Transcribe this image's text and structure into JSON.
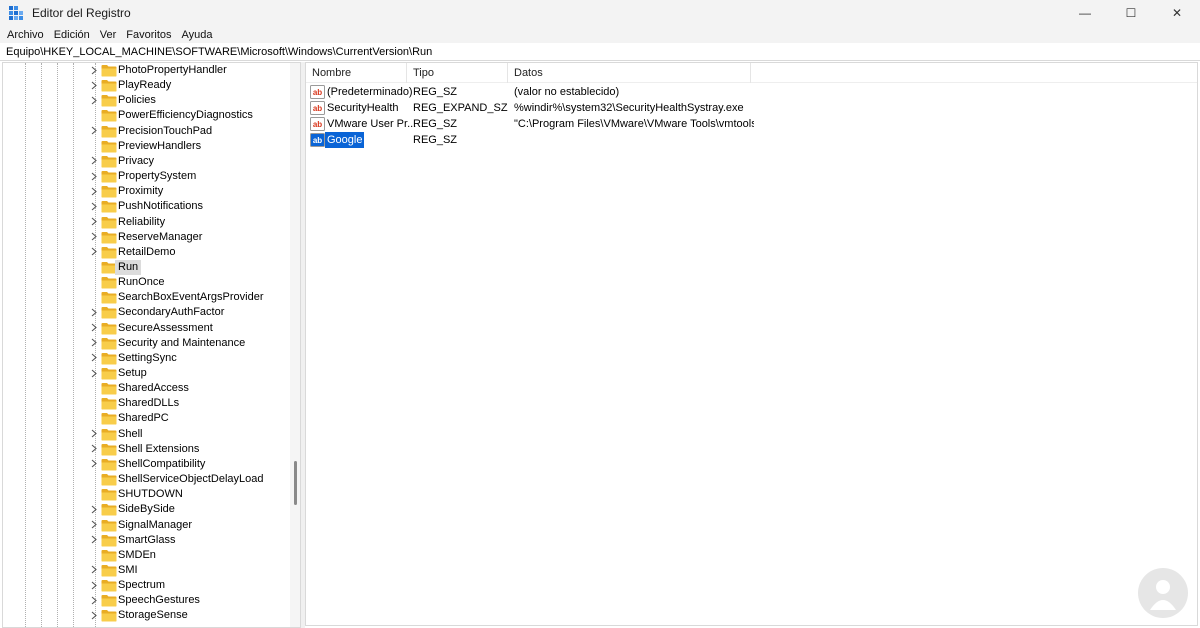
{
  "window": {
    "title": "Editor del Registro",
    "controls": {
      "minimize": "—",
      "maximize": "☐",
      "close": "✕"
    }
  },
  "menu": [
    "Archivo",
    "Edición",
    "Ver",
    "Favoritos",
    "Ayuda"
  ],
  "address": "Equipo\\HKEY_LOCAL_MACHINE\\SOFTWARE\\Microsoft\\Windows\\CurrentVersion\\Run",
  "tree": {
    "items": [
      {
        "label": "PhotoPropertyHandler",
        "expandable": true
      },
      {
        "label": "PlayReady",
        "expandable": true
      },
      {
        "label": "Policies",
        "expandable": true
      },
      {
        "label": "PowerEfficiencyDiagnostics",
        "expandable": false
      },
      {
        "label": "PrecisionTouchPad",
        "expandable": true
      },
      {
        "label": "PreviewHandlers",
        "expandable": false
      },
      {
        "label": "Privacy",
        "expandable": true
      },
      {
        "label": "PropertySystem",
        "expandable": true
      },
      {
        "label": "Proximity",
        "expandable": true
      },
      {
        "label": "PushNotifications",
        "expandable": true
      },
      {
        "label": "Reliability",
        "expandable": true
      },
      {
        "label": "ReserveManager",
        "expandable": true
      },
      {
        "label": "RetailDemo",
        "expandable": true
      },
      {
        "label": "Run",
        "expandable": false,
        "selected": true
      },
      {
        "label": "RunOnce",
        "expandable": false
      },
      {
        "label": "SearchBoxEventArgsProvider",
        "expandable": false
      },
      {
        "label": "SecondaryAuthFactor",
        "expandable": true
      },
      {
        "label": "SecureAssessment",
        "expandable": true
      },
      {
        "label": "Security and Maintenance",
        "expandable": true
      },
      {
        "label": "SettingSync",
        "expandable": true
      },
      {
        "label": "Setup",
        "expandable": true
      },
      {
        "label": "SharedAccess",
        "expandable": false
      },
      {
        "label": "SharedDLLs",
        "expandable": false
      },
      {
        "label": "SharedPC",
        "expandable": false
      },
      {
        "label": "Shell",
        "expandable": true
      },
      {
        "label": "Shell Extensions",
        "expandable": true
      },
      {
        "label": "ShellCompatibility",
        "expandable": true
      },
      {
        "label": "ShellServiceObjectDelayLoad",
        "expandable": false
      },
      {
        "label": "SHUTDOWN",
        "expandable": false
      },
      {
        "label": "SideBySide",
        "expandable": true
      },
      {
        "label": "SignalManager",
        "expandable": true
      },
      {
        "label": "SmartGlass",
        "expandable": true
      },
      {
        "label": "SMDEn",
        "expandable": false
      },
      {
        "label": "SMI",
        "expandable": true
      },
      {
        "label": "Spectrum",
        "expandable": true
      },
      {
        "label": "SpeechGestures",
        "expandable": true
      },
      {
        "label": "StorageSense",
        "expandable": true
      }
    ]
  },
  "list": {
    "columns": [
      "Nombre",
      "Tipo",
      "Datos"
    ],
    "rows": [
      {
        "name": "(Predeterminado)",
        "type": "REG_SZ",
        "data": "(valor no establecido)",
        "selected": false
      },
      {
        "name": "SecurityHealth",
        "type": "REG_EXPAND_SZ",
        "data": "%windir%\\system32\\SecurityHealthSystray.exe",
        "selected": false
      },
      {
        "name": "VMware User Pr...",
        "type": "REG_SZ",
        "data": "\"C:\\Program Files\\VMware\\VMware Tools\\vmtools...",
        "selected": false
      },
      {
        "name": "Google",
        "type": "REG_SZ",
        "data": "",
        "selected": true
      }
    ]
  },
  "colors": {
    "selection": "#0a64d6",
    "tree_selection": "#dcdcdc",
    "folder": "#f3c23c",
    "value_icon_red": "#d8361c",
    "value_icon_blue": "#ffffff"
  }
}
